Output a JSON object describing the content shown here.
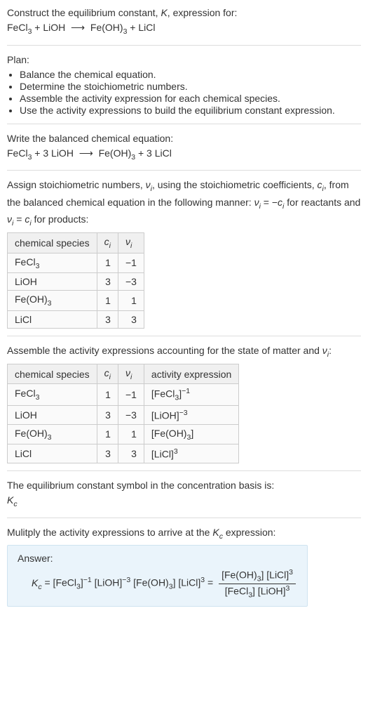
{
  "intro": {
    "prompt": "Construct the equilibrium constant, K, expression for:",
    "equation": "FeCl₃ + LiOH ⟶ Fe(OH)₃ + LiCl"
  },
  "plan": {
    "heading": "Plan:",
    "items": [
      "Balance the chemical equation.",
      "Determine the stoichiometric numbers.",
      "Assemble the activity expression for each chemical species.",
      "Use the activity expressions to build the equilibrium constant expression."
    ]
  },
  "balanced": {
    "heading": "Write the balanced chemical equation:",
    "equation": "FeCl₃ + 3 LiOH ⟶ Fe(OH)₃ + 3 LiCl"
  },
  "assign": {
    "text": "Assign stoichiometric numbers, νᵢ, using the stoichiometric coefficients, cᵢ, from the balanced chemical equation in the following manner: νᵢ = −cᵢ for reactants and νᵢ = cᵢ for products:",
    "headers": [
      "chemical species",
      "cᵢ",
      "νᵢ"
    ],
    "rows": [
      {
        "species": "FeCl₃",
        "c": "1",
        "v": "−1"
      },
      {
        "species": "LiOH",
        "c": "3",
        "v": "−3"
      },
      {
        "species": "Fe(OH)₃",
        "c": "1",
        "v": "1"
      },
      {
        "species": "LiCl",
        "c": "3",
        "v": "3"
      }
    ]
  },
  "activity": {
    "text": "Assemble the activity expressions accounting for the state of matter and νᵢ:",
    "headers": [
      "chemical species",
      "cᵢ",
      "νᵢ",
      "activity expression"
    ],
    "rows": [
      {
        "species": "FeCl₃",
        "c": "1",
        "v": "−1",
        "expr": "[FeCl₃]⁻¹"
      },
      {
        "species": "LiOH",
        "c": "3",
        "v": "−3",
        "expr": "[LiOH]⁻³"
      },
      {
        "species": "Fe(OH)₃",
        "c": "1",
        "v": "1",
        "expr": "[Fe(OH)₃]"
      },
      {
        "species": "LiCl",
        "c": "3",
        "v": "3",
        "expr": "[LiCl]³"
      }
    ]
  },
  "symbol": {
    "text": "The equilibrium constant symbol in the concentration basis is:",
    "sym": "K𝒸"
  },
  "multiply": {
    "text": "Mulitply the activity expressions to arrive at the K𝒸 expression:"
  },
  "answer": {
    "label": "Answer:",
    "lhs": "K𝒸 = [FeCl₃]⁻¹ [LiOH]⁻³ [Fe(OH)₃] [LiCl]³ = ",
    "num": "[Fe(OH)₃] [LiCl]³",
    "den": "[FeCl₃] [LiOH]³"
  }
}
